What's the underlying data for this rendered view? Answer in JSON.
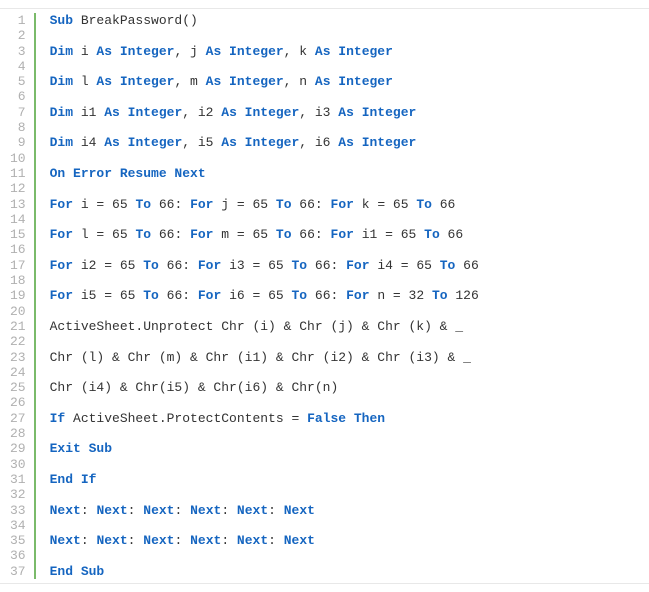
{
  "code": {
    "totalLines": 37,
    "lines": [
      {
        "n": 1,
        "tokens": [
          {
            "cls": "kw",
            "t": "Sub"
          },
          {
            "cls": "ident",
            "t": " BreakPassword()"
          }
        ]
      },
      {
        "n": 2,
        "tokens": []
      },
      {
        "n": 3,
        "tokens": [
          {
            "cls": "kw",
            "t": "Dim"
          },
          {
            "cls": "ident",
            "t": " i "
          },
          {
            "cls": "kw",
            "t": "As Integer"
          },
          {
            "cls": "ident",
            "t": ", j "
          },
          {
            "cls": "kw",
            "t": "As Integer"
          },
          {
            "cls": "ident",
            "t": ", k "
          },
          {
            "cls": "kw",
            "t": "As Integer"
          }
        ]
      },
      {
        "n": 4,
        "tokens": []
      },
      {
        "n": 5,
        "tokens": [
          {
            "cls": "kw",
            "t": "Dim"
          },
          {
            "cls": "ident",
            "t": " l "
          },
          {
            "cls": "kw",
            "t": "As Integer"
          },
          {
            "cls": "ident",
            "t": ", m "
          },
          {
            "cls": "kw",
            "t": "As Integer"
          },
          {
            "cls": "ident",
            "t": ", n "
          },
          {
            "cls": "kw",
            "t": "As Integer"
          }
        ]
      },
      {
        "n": 6,
        "tokens": []
      },
      {
        "n": 7,
        "tokens": [
          {
            "cls": "kw",
            "t": "Dim"
          },
          {
            "cls": "ident",
            "t": " i1 "
          },
          {
            "cls": "kw",
            "t": "As Integer"
          },
          {
            "cls": "ident",
            "t": ", i2 "
          },
          {
            "cls": "kw",
            "t": "As Integer"
          },
          {
            "cls": "ident",
            "t": ", i3 "
          },
          {
            "cls": "kw",
            "t": "As Integer"
          }
        ]
      },
      {
        "n": 8,
        "tokens": []
      },
      {
        "n": 9,
        "tokens": [
          {
            "cls": "kw",
            "t": "Dim"
          },
          {
            "cls": "ident",
            "t": " i4 "
          },
          {
            "cls": "kw",
            "t": "As Integer"
          },
          {
            "cls": "ident",
            "t": ", i5 "
          },
          {
            "cls": "kw",
            "t": "As Integer"
          },
          {
            "cls": "ident",
            "t": ", i6 "
          },
          {
            "cls": "kw",
            "t": "As Integer"
          }
        ]
      },
      {
        "n": 10,
        "tokens": []
      },
      {
        "n": 11,
        "tokens": [
          {
            "cls": "kw",
            "t": "On Error Resume Next"
          }
        ]
      },
      {
        "n": 12,
        "tokens": []
      },
      {
        "n": 13,
        "tokens": [
          {
            "cls": "kw",
            "t": "For"
          },
          {
            "cls": "ident",
            "t": " i = 65 "
          },
          {
            "cls": "kw",
            "t": "To"
          },
          {
            "cls": "ident",
            "t": " 66: "
          },
          {
            "cls": "kw",
            "t": "For"
          },
          {
            "cls": "ident",
            "t": " j = 65 "
          },
          {
            "cls": "kw",
            "t": "To"
          },
          {
            "cls": "ident",
            "t": " 66: "
          },
          {
            "cls": "kw",
            "t": "For"
          },
          {
            "cls": "ident",
            "t": " k = 65 "
          },
          {
            "cls": "kw",
            "t": "To"
          },
          {
            "cls": "ident",
            "t": " 66"
          }
        ]
      },
      {
        "n": 14,
        "tokens": []
      },
      {
        "n": 15,
        "tokens": [
          {
            "cls": "kw",
            "t": "For"
          },
          {
            "cls": "ident",
            "t": " l = 65 "
          },
          {
            "cls": "kw",
            "t": "To"
          },
          {
            "cls": "ident",
            "t": " 66: "
          },
          {
            "cls": "kw",
            "t": "For"
          },
          {
            "cls": "ident",
            "t": " m = 65 "
          },
          {
            "cls": "kw",
            "t": "To"
          },
          {
            "cls": "ident",
            "t": " 66: "
          },
          {
            "cls": "kw",
            "t": "For"
          },
          {
            "cls": "ident",
            "t": " i1 = 65 "
          },
          {
            "cls": "kw",
            "t": "To"
          },
          {
            "cls": "ident",
            "t": " 66"
          }
        ]
      },
      {
        "n": 16,
        "tokens": []
      },
      {
        "n": 17,
        "tokens": [
          {
            "cls": "kw",
            "t": "For"
          },
          {
            "cls": "ident",
            "t": " i2 = 65 "
          },
          {
            "cls": "kw",
            "t": "To"
          },
          {
            "cls": "ident",
            "t": " 66: "
          },
          {
            "cls": "kw",
            "t": "For"
          },
          {
            "cls": "ident",
            "t": " i3 = 65 "
          },
          {
            "cls": "kw",
            "t": "To"
          },
          {
            "cls": "ident",
            "t": " 66: "
          },
          {
            "cls": "kw",
            "t": "For"
          },
          {
            "cls": "ident",
            "t": " i4 = 65 "
          },
          {
            "cls": "kw",
            "t": "To"
          },
          {
            "cls": "ident",
            "t": " 66"
          }
        ]
      },
      {
        "n": 18,
        "tokens": []
      },
      {
        "n": 19,
        "tokens": [
          {
            "cls": "kw",
            "t": "For"
          },
          {
            "cls": "ident",
            "t": " i5 = 65 "
          },
          {
            "cls": "kw",
            "t": "To"
          },
          {
            "cls": "ident",
            "t": " 66: "
          },
          {
            "cls": "kw",
            "t": "For"
          },
          {
            "cls": "ident",
            "t": " i6 = 65 "
          },
          {
            "cls": "kw",
            "t": "To"
          },
          {
            "cls": "ident",
            "t": " 66: "
          },
          {
            "cls": "kw",
            "t": "For"
          },
          {
            "cls": "ident",
            "t": " n = 32 "
          },
          {
            "cls": "kw",
            "t": "To"
          },
          {
            "cls": "ident",
            "t": " 126"
          }
        ]
      },
      {
        "n": 20,
        "tokens": []
      },
      {
        "n": 21,
        "tokens": [
          {
            "cls": "ident",
            "t": "ActiveSheet.Unprotect Chr (i) & Chr (j) & Chr (k) & _"
          }
        ]
      },
      {
        "n": 22,
        "tokens": []
      },
      {
        "n": 23,
        "tokens": [
          {
            "cls": "ident",
            "t": "Chr (l) & Chr (m) & Chr (i1) & Chr (i2) & Chr (i3) & _"
          }
        ]
      },
      {
        "n": 24,
        "tokens": []
      },
      {
        "n": 25,
        "tokens": [
          {
            "cls": "ident",
            "t": "Chr (i4) & Chr(i5) & Chr(i6) & Chr(n)"
          }
        ]
      },
      {
        "n": 26,
        "tokens": []
      },
      {
        "n": 27,
        "tokens": [
          {
            "cls": "kw",
            "t": "If"
          },
          {
            "cls": "ident",
            "t": " ActiveSheet.ProtectContents = "
          },
          {
            "cls": "kw",
            "t": "False Then"
          }
        ]
      },
      {
        "n": 28,
        "tokens": []
      },
      {
        "n": 29,
        "tokens": [
          {
            "cls": "kw",
            "t": "Exit Sub"
          }
        ]
      },
      {
        "n": 30,
        "tokens": []
      },
      {
        "n": 31,
        "tokens": [
          {
            "cls": "kw",
            "t": "End If"
          }
        ]
      },
      {
        "n": 32,
        "tokens": []
      },
      {
        "n": 33,
        "tokens": [
          {
            "cls": "kw",
            "t": "Next"
          },
          {
            "cls": "ident",
            "t": ": "
          },
          {
            "cls": "kw",
            "t": "Next"
          },
          {
            "cls": "ident",
            "t": ": "
          },
          {
            "cls": "kw",
            "t": "Next"
          },
          {
            "cls": "ident",
            "t": ": "
          },
          {
            "cls": "kw",
            "t": "Next"
          },
          {
            "cls": "ident",
            "t": ": "
          },
          {
            "cls": "kw",
            "t": "Next"
          },
          {
            "cls": "ident",
            "t": ": "
          },
          {
            "cls": "kw",
            "t": "Next"
          }
        ]
      },
      {
        "n": 34,
        "tokens": []
      },
      {
        "n": 35,
        "tokens": [
          {
            "cls": "kw",
            "t": "Next"
          },
          {
            "cls": "ident",
            "t": ": "
          },
          {
            "cls": "kw",
            "t": "Next"
          },
          {
            "cls": "ident",
            "t": ": "
          },
          {
            "cls": "kw",
            "t": "Next"
          },
          {
            "cls": "ident",
            "t": ": "
          },
          {
            "cls": "kw",
            "t": "Next"
          },
          {
            "cls": "ident",
            "t": ": "
          },
          {
            "cls": "kw",
            "t": "Next"
          },
          {
            "cls": "ident",
            "t": ": "
          },
          {
            "cls": "kw",
            "t": "Next"
          }
        ]
      },
      {
        "n": 36,
        "tokens": []
      },
      {
        "n": 37,
        "tokens": [
          {
            "cls": "kw",
            "t": "End Sub"
          }
        ]
      }
    ]
  }
}
